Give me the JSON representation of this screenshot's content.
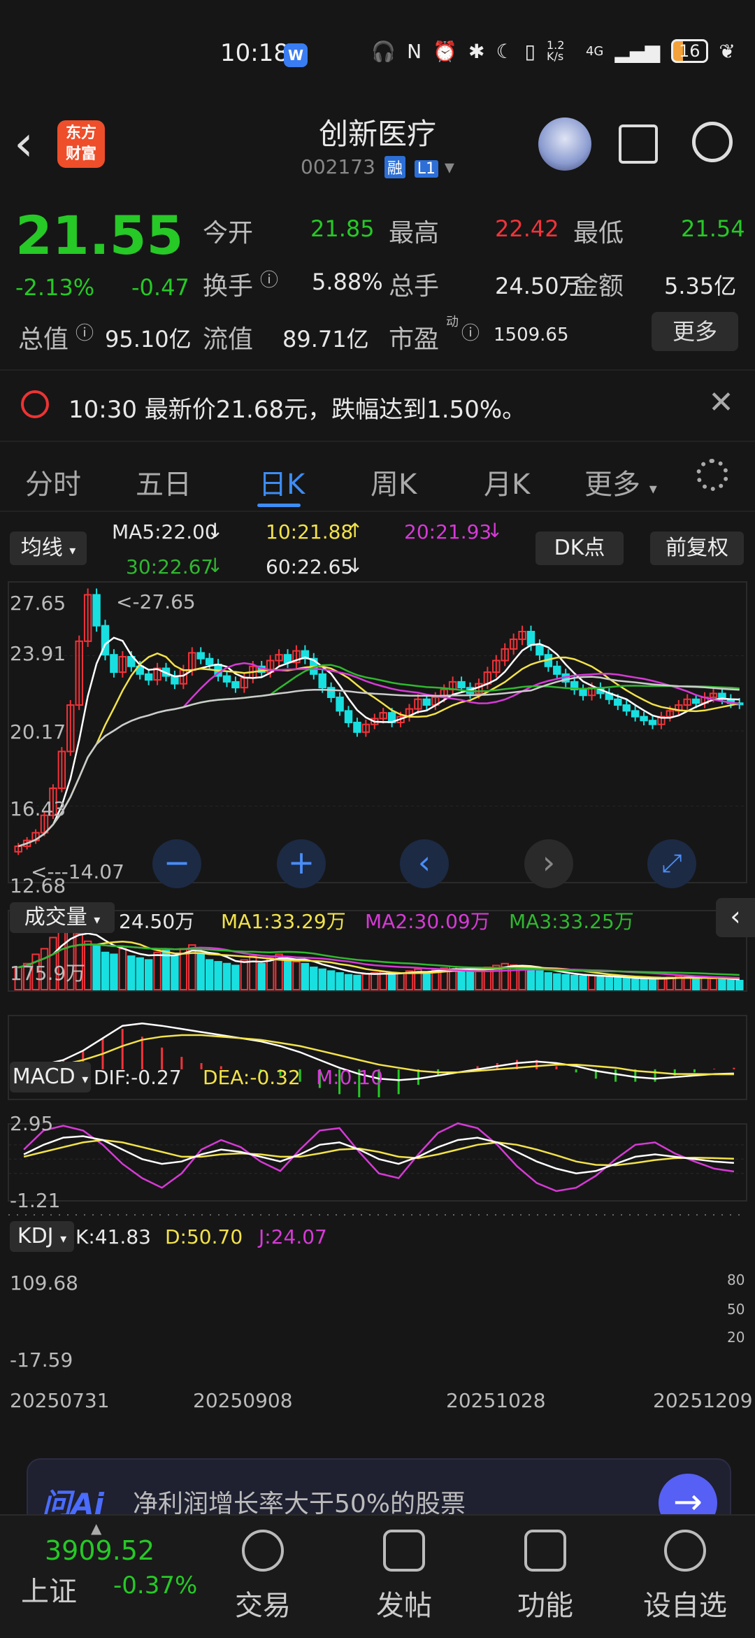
{
  "status_bar": {
    "time": "10:18",
    "net_speed": "1.2 K/s",
    "network": "4G",
    "battery": "16"
  },
  "header": {
    "stock_name": "创新医疗",
    "stock_code": "002173",
    "tag_margin": "融",
    "tag_level": "L1"
  },
  "quote": {
    "price": "21.55",
    "change_pct": "-2.13%",
    "change": "-0.47",
    "open_label": "今开",
    "open": "21.85",
    "high_label": "最高",
    "high": "22.42",
    "low_label": "最低",
    "low": "21.54",
    "turnover_label": "换手",
    "turnover": "5.88%",
    "volume_label": "总手",
    "volume": "24.50万",
    "amount_label": "金额",
    "amount": "5.35亿",
    "mktcap_label": "总值",
    "mktcap": "95.10亿",
    "float_label": "流值",
    "float_cap": "89.71亿",
    "pe_label": "市盈",
    "pe_sup": "动",
    "pe": "1509.65",
    "more_label": "更多"
  },
  "alert": {
    "text": "10:30  最新价21.68元，跌幅达到1.50%。"
  },
  "tabs": [
    {
      "label": "分时"
    },
    {
      "label": "五日"
    },
    {
      "label": "日K"
    },
    {
      "label": "周K"
    },
    {
      "label": "月K"
    },
    {
      "label": "更多"
    }
  ],
  "chart_controls": {
    "ma_button": "均线",
    "dk_button": "DK点",
    "adjust_button": "前复权"
  },
  "ma_legend": {
    "ma5": "MA5:22.00",
    "ma10": "10:21.88",
    "ma20": "20:21.93",
    "ma30": "30:22.67",
    "ma60": "60:22.65"
  },
  "price_axis": {
    "ticks": [
      "27.65",
      "23.91",
      "20.17",
      "16.43",
      "12.68"
    ],
    "max_mark": "<-27.65",
    "min_mark": "<---14.07"
  },
  "volume_panel": {
    "label": "成交量",
    "vol": "24.50万",
    "ma1": "MA1:33.29万",
    "ma2": "MA2:30.09万",
    "ma3": "MA3:33.25万",
    "tick": "175.9万"
  },
  "macd_panel": {
    "label": "MACD",
    "dif": "DIF:-0.27",
    "dea": "DEA:-0.32",
    "m": "M:0.10",
    "ticks": [
      "2.95",
      "-1.21"
    ]
  },
  "kdj_panel": {
    "label": "KDJ",
    "k": "K:41.83",
    "d": "D:50.70",
    "j": "J:24.07",
    "ticks": [
      "109.68",
      "-17.59"
    ],
    "right_ticks": [
      "80",
      "50",
      "20"
    ]
  },
  "date_axis": {
    "dates": [
      "20250731",
      "20250908",
      "20251028",
      "20251209"
    ]
  },
  "ai_bar": {
    "brand": "问Ai",
    "text": "净利润增长率大于50%的股票"
  },
  "bottom_nav": {
    "index_value": "3909.52",
    "index_name": "上证",
    "index_change": "-0.37%",
    "items": [
      {
        "label": "交易"
      },
      {
        "label": "发帖"
      },
      {
        "label": "功能"
      },
      {
        "label": "设自选"
      }
    ]
  },
  "colors": {
    "up": "#f2333a",
    "down": "#26c926",
    "accent": "#3d8df5",
    "bar_down": "#19e0e0"
  },
  "chart_data": {
    "type": "candlestick",
    "title": "",
    "ylim": [
      12.68,
      27.65
    ],
    "close": [
      14.2,
      14.5,
      14.9,
      15.8,
      17.2,
      19.1,
      21.5,
      24.8,
      27.2,
      25.6,
      24.1,
      23.2,
      24.0,
      23.5,
      23.1,
      22.8,
      23.4,
      23.0,
      22.6,
      23.3,
      24.2,
      23.9,
      23.6,
      23.0,
      22.7,
      22.4,
      22.9,
      23.5,
      23.2,
      23.8,
      24.1,
      23.7,
      24.3,
      23.9,
      23.1,
      22.4,
      21.9,
      21.2,
      20.6,
      20.1,
      20.5,
      20.8,
      21.1,
      20.6,
      20.9,
      21.3,
      21.8,
      21.5,
      21.9,
      22.3,
      22.7,
      22.4,
      22.1,
      22.6,
      23.2,
      23.8,
      24.4,
      24.9,
      25.3,
      24.6,
      24.1,
      23.5,
      23.1,
      22.7,
      22.3,
      22.0,
      22.4,
      22.1,
      21.8,
      21.5,
      21.2,
      20.9,
      20.7,
      20.5,
      20.9,
      21.2,
      21.5,
      21.8,
      21.6,
      21.9,
      22.1,
      21.8,
      21.6,
      21.55
    ],
    "volume": [
      60,
      70,
      95,
      110,
      140,
      175,
      160,
      150,
      130,
      120,
      100,
      95,
      110,
      90,
      85,
      80,
      100,
      105,
      90,
      110,
      120,
      95,
      80,
      75,
      70,
      65,
      80,
      90,
      70,
      85,
      95,
      80,
      75,
      70,
      60,
      55,
      50,
      45,
      40,
      38,
      42,
      45,
      48,
      40,
      44,
      50,
      55,
      48,
      52,
      58,
      62,
      55,
      50,
      56,
      60,
      65,
      70,
      66,
      60,
      55,
      50,
      45,
      42,
      40,
      38,
      36,
      38,
      35,
      33,
      32,
      30,
      28,
      30,
      29,
      31,
      33,
      35,
      34,
      32,
      31,
      30,
      28,
      26,
      24.5
    ],
    "macd": {
      "dif": [
        0.1,
        0.3,
        0.6,
        1.2,
        2.0,
        2.8,
        2.95,
        2.8,
        2.6,
        2.4,
        2.2,
        2.0,
        1.8,
        1.5,
        1.1,
        0.6,
        0.1,
        -0.3,
        -0.6,
        -0.7,
        -0.6,
        -0.4,
        -0.2,
        0.0,
        0.2,
        0.4,
        0.5,
        0.4,
        0.2,
        -0.1,
        -0.3,
        -0.5,
        -0.6,
        -0.5,
        -0.4,
        -0.3,
        -0.27
      ],
      "dea": [
        0.0,
        0.1,
        0.3,
        0.6,
        1.0,
        1.5,
        1.9,
        2.1,
        2.2,
        2.2,
        2.1,
        2.0,
        1.9,
        1.7,
        1.5,
        1.2,
        0.9,
        0.6,
        0.3,
        0.1,
        -0.1,
        -0.2,
        -0.2,
        -0.1,
        0.0,
        0.1,
        0.2,
        0.3,
        0.3,
        0.2,
        0.1,
        -0.1,
        -0.2,
        -0.3,
        -0.3,
        -0.32,
        -0.32
      ]
    },
    "kdj": {
      "k": [
        60,
        80,
        95,
        98,
        90,
        70,
        50,
        40,
        45,
        60,
        70,
        65,
        55,
        45,
        60,
        80,
        85,
        70,
        50,
        40,
        55,
        75,
        90,
        95,
        85,
        65,
        45,
        30,
        20,
        25,
        40,
        55,
        60,
        55,
        50,
        45,
        41.83
      ],
      "d": [
        55,
        65,
        75,
        85,
        90,
        85,
        75,
        65,
        55,
        55,
        60,
        62,
        60,
        55,
        55,
        62,
        70,
        72,
        65,
        55,
        52,
        60,
        70,
        80,
        85,
        80,
        70,
        58,
        45,
        38,
        37,
        42,
        48,
        52,
        53,
        52,
        50.7
      ],
      "j": [
        70,
        110,
        120,
        110,
        80,
        40,
        10,
        -10,
        20,
        70,
        90,
        75,
        45,
        25,
        70,
        110,
        115,
        65,
        20,
        10,
        60,
        105,
        125,
        115,
        80,
        35,
        0,
        -17,
        -10,
        15,
        50,
        80,
        85,
        62,
        45,
        30,
        24.07
      ]
    }
  }
}
